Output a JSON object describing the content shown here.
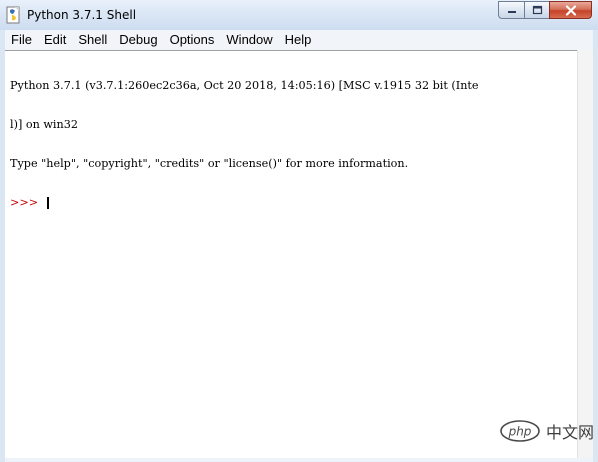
{
  "window": {
    "title": "Python 3.7.1 Shell",
    "icon": "python-idle-icon",
    "buttons": {
      "minimize": "minimize-icon",
      "maximize": "maximize-icon",
      "close": "close-icon"
    }
  },
  "menu": {
    "items": [
      "File",
      "Edit",
      "Shell",
      "Debug",
      "Options",
      "Window",
      "Help"
    ]
  },
  "shell": {
    "lines": [
      "Python 3.7.1 (v3.7.1:260ec2c36a, Oct 20 2018, 14:05:16) [MSC v.1915 32 bit (Inte",
      "l)] on win32",
      "Type \"help\", \"copyright\", \"credits\" or \"license()\" for more information."
    ],
    "prompt": ">>> "
  },
  "watermark": {
    "logo_text": "php",
    "text": "中文网"
  },
  "colors": {
    "prompt": "#c00000",
    "close_button": "#c4432a",
    "background": "#ffffff"
  }
}
